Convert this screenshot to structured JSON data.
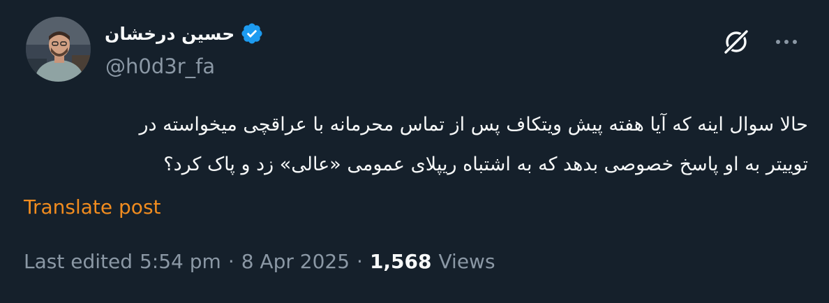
{
  "author": {
    "display_name": "حسین درخشان",
    "handle": "@h0d3r_fa",
    "verified": true
  },
  "post": {
    "text_lines": [
      "حالا سوال اینه که آیا هفته پیش ویتکاف پس از تماس محرمانه با عراقچی میخواسته در",
      "توییتر به او پاسخ خصوصی بدهد که به اشتباه ریپلای عمومی «عالی» زد و پاک کرد؟"
    ],
    "translate_label": "Translate post"
  },
  "meta": {
    "edited_label": "Last edited",
    "time": "5:54 pm",
    "date": "8 Apr 2025",
    "separator": "·",
    "views_count": "1,568",
    "views_label": "Views"
  },
  "icons": {
    "verified": "verified-badge-icon",
    "grok": "grok-icon",
    "more": "more-icon"
  },
  "colors": {
    "background": "#15202b",
    "text_primary": "#f7f9f9",
    "text_secondary": "#8b98a5",
    "link_translate": "#f18c1f",
    "verified_blue": "#1d9bf0"
  }
}
